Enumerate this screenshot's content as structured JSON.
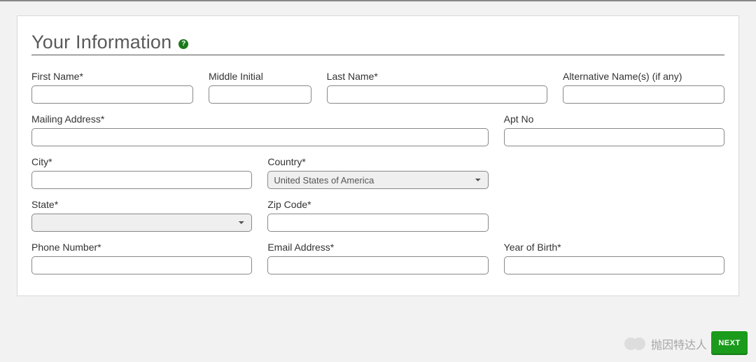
{
  "heading": "Your Information",
  "help_symbol": "?",
  "labels": {
    "first_name": "First Name*",
    "middle_initial": "Middle Initial",
    "last_name": "Last Name*",
    "alt_name": "Alternative Name(s) (if any)",
    "mailing_address": "Mailing Address*",
    "apt_no": "Apt No",
    "city": "City*",
    "country": "Country*",
    "state": "State*",
    "zip": "Zip Code*",
    "phone": "Phone Number*",
    "email": "Email Address*",
    "yob": "Year of Birth*"
  },
  "values": {
    "first_name": "",
    "middle_initial": "",
    "last_name": "",
    "alt_name": "",
    "mailing_address": "",
    "apt_no": "",
    "city": "",
    "country": "United States of America",
    "state": "",
    "zip": "",
    "phone": "",
    "email": "",
    "yob": ""
  },
  "next_button": "NEXT",
  "watermark": "抛因特达人"
}
